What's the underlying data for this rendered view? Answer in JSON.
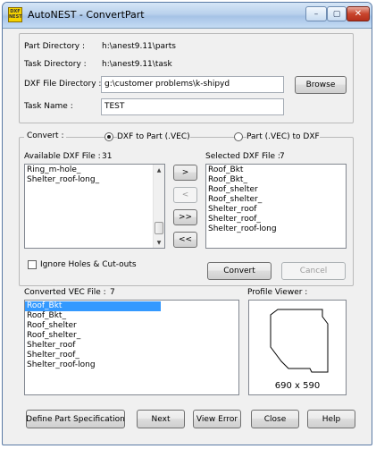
{
  "window": {
    "title": "AutoNEST - ConvertPart",
    "icon_text": "DXF NEST",
    "minimize_glyph": "–",
    "maximize_glyph": "▢",
    "close_glyph": "✕"
  },
  "directories": {
    "part_label": "Part Directory :",
    "part_value": "h:\\anest9.11\\parts",
    "task_label": "Task Directory :",
    "task_value": "h:\\anest9.11\\task",
    "dxf_label": "DXF File Directory :",
    "dxf_value": "g:\\customer problems\\k-shipyd",
    "browse_label": "Browse",
    "task_name_label": "Task Name :",
    "task_name_value": "TEST"
  },
  "convert": {
    "label": "Convert :",
    "option_dxf_to_part": "DXF to Part (.VEC)",
    "option_part_to_dxf": "Part (.VEC) to DXF",
    "selected_option": "DXF to Part (.VEC)",
    "available_label": "Available DXF File :",
    "available_count": "31",
    "available_files": [
      "Ring_m-hole_",
      "Shelter_roof-long_"
    ],
    "selected_label": "Selected DXF File :",
    "selected_count": "7",
    "selected_files": [
      "Roof_Bkt",
      "Roof_Bkt_",
      "Roof_shelter",
      "Roof_shelter_",
      "Shelter_roof",
      "Shelter_roof_",
      "Shelter_roof-long"
    ],
    "move_one_right": ">",
    "move_one_left": "<",
    "move_all_right": ">>",
    "move_all_left": "<<",
    "ignore_holes_label": "Ignore Holes & Cut-outs",
    "ignore_holes_checked": false,
    "convert_button": "Convert",
    "cancel_button": "Cancel"
  },
  "converted": {
    "label": "Converted VEC File :",
    "count": "7",
    "files": [
      "Roof_Bkt",
      "Roof_Bkt_",
      "Roof_shelter",
      "Roof_shelter_",
      "Shelter_roof",
      "Shelter_roof_",
      "Shelter_roof-long"
    ],
    "selected_file": "Roof_Bkt"
  },
  "profile_viewer": {
    "label": "Profile Viewer :",
    "dimensions": "690 x 590"
  },
  "footer": {
    "define_part_spec": "Define Part Specification",
    "next": "Next",
    "view_error": "View Error",
    "close": "Close",
    "help": "Help"
  },
  "colors": {
    "selection": "#3399ff",
    "window_bg": "#f0f0f0",
    "close_button": "#c8452d"
  }
}
